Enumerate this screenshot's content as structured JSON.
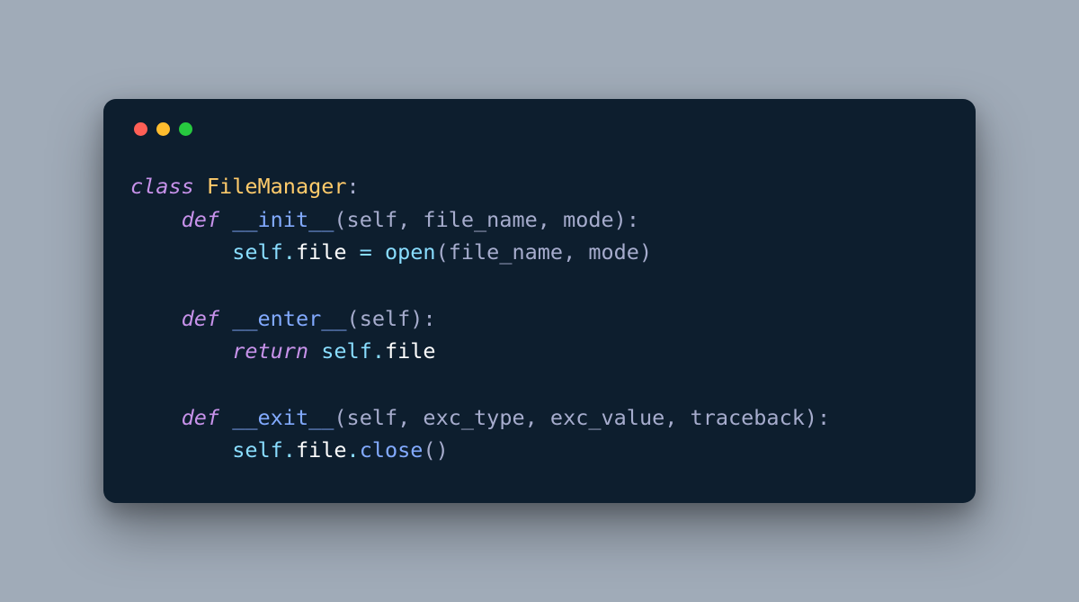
{
  "colors": {
    "background": "#a0abb8",
    "window_bg": "#0d1e2e",
    "dot_red": "#ff5f56",
    "dot_yellow": "#ffbd2e",
    "dot_green": "#27c93f"
  },
  "code": {
    "l1_kw": "class",
    "l1_name": "FileManager",
    "l1_colon": ":",
    "l2_indent": "    ",
    "l2_kw": "def",
    "l2_fn": "__init__",
    "l2_paren_open": "(",
    "l2_params": "self, file_name, mode",
    "l2_paren_close_colon": "):",
    "l3_indent": "        ",
    "l3_self": "self",
    "l3_dot": ".",
    "l3_attr": "file",
    "l3_eq": " = ",
    "l3_open": "open",
    "l3_args_open": "(",
    "l3_args": "file_name, mode",
    "l3_args_close": ")",
    "l5_indent": "    ",
    "l5_kw": "def",
    "l5_fn": "__enter__",
    "l5_params": "self",
    "l6_indent": "        ",
    "l6_kw": "return",
    "l6_self": "self",
    "l6_dot": ".",
    "l6_attr": "file",
    "l8_indent": "    ",
    "l8_kw": "def",
    "l8_fn": "__exit__",
    "l8_params": "self, exc_type, exc_value, traceback",
    "l9_indent": "        ",
    "l9_self": "self",
    "l9_dot1": ".",
    "l9_attr1": "file",
    "l9_dot2": ".",
    "l9_method": "close",
    "l9_parens": "()"
  }
}
